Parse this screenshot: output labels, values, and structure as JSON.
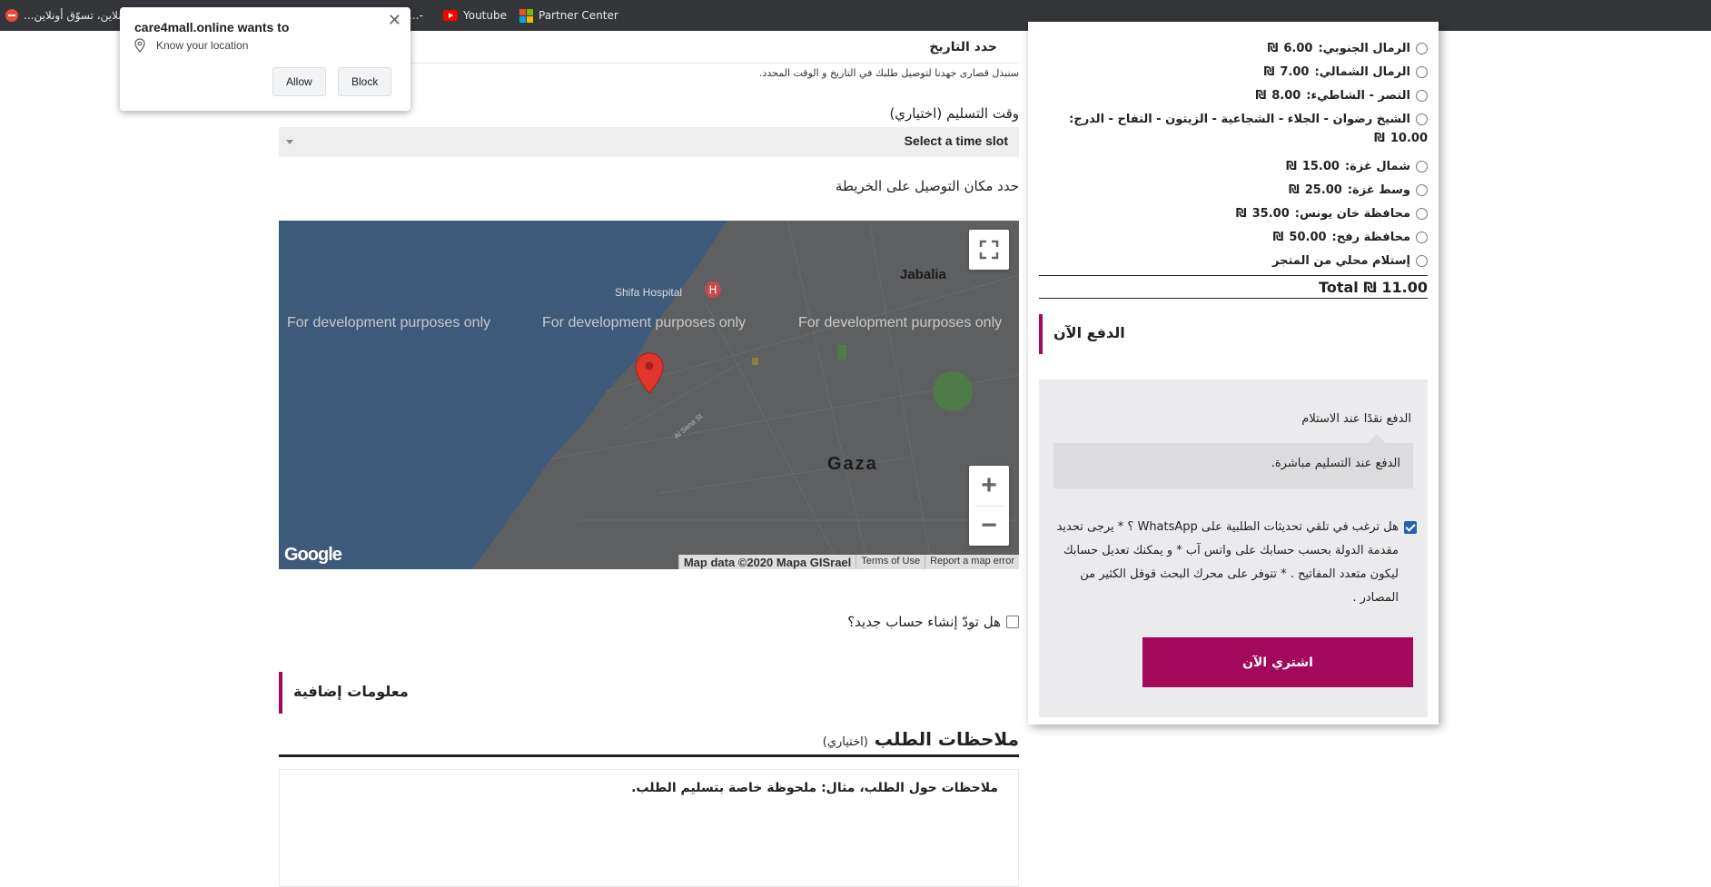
{
  "bookmarks": {
    "item1": "كارفور أونلاين، تسوّق أونلاين...",
    "item2": "...-",
    "youtube": "Youtube",
    "partner": "Partner Center"
  },
  "permission_popup": {
    "title": "care4mall.online wants to",
    "location": "Know your location",
    "allow": "Allow",
    "block": "Block"
  },
  "delivery": {
    "date_value": "حدد التاريخ",
    "date_note": "سنبذل قصارى جهدنا لتوصيل طلبك في التاريخ و الوقت المحدد.",
    "time_label": "وقت التسليم (اختياري)",
    "time_select": "Select a time slot",
    "map_label": "حدد مكان التوصيل على الخريطة"
  },
  "map": {
    "dev_text": "For development purposes only",
    "places": {
      "jabalia": "Jabalia",
      "shifa": "Shifa Hospital",
      "gaza": "Gaza",
      "street": "Al Sena St"
    },
    "attribution": {
      "data": "Map data ©2020 Mapa GISrael",
      "terms": "Terms of Use",
      "report": "Report a map error"
    },
    "logo": "Google"
  },
  "account": {
    "create_label": "هل تودّ إنشاء حساب جديد؟"
  },
  "additional": {
    "heading": "معلومات إضافية",
    "notes_title": "ملاحظات الطلب",
    "notes_optional": "(اختياري)",
    "notes_placeholder": "ملاحظات حول الطلب، مثال: ملحوظة خاصة بتسليم الطلب."
  },
  "shipping": {
    "options": [
      {
        "label": "الرمال الجنوبي:",
        "price": "6.00",
        "currency": "₪"
      },
      {
        "label": "الرمال الشمالي:",
        "price": "7.00",
        "currency": "₪"
      },
      {
        "label": "التصر - الشاطيء:",
        "price": "8.00",
        "currency": "₪"
      },
      {
        "label": "الشيخ رضوان - الجلاء - الشجاعية - الزيتون - التفاح - الدرج:",
        "price": "10.00",
        "currency": "₪"
      },
      {
        "label": "شمال غزة:",
        "price": "15.00",
        "currency": "₪"
      },
      {
        "label": "وسط غزة:",
        "price": "25.00",
        "currency": "₪"
      },
      {
        "label": "محافظة خان يونس:",
        "price": "35.00",
        "currency": "₪"
      },
      {
        "label": "محافظة رفح:",
        "price": "50.00",
        "currency": "₪"
      },
      {
        "label": "إستلام محلي من المتجر",
        "price": "",
        "currency": ""
      }
    ]
  },
  "total": {
    "label": "Total",
    "value": "11.00",
    "currency": "₪"
  },
  "payment": {
    "heading": "الدفع الآن",
    "method": "الدفع نقدًا عند الاستلام",
    "description": "الدفع عند التسليم مباشرة.",
    "whatsapp_text": "هل ترغب في تلقي تحديثات الطلبية على WhatsApp ؟ * يرجى تحديد مقدمة الدولة بحسب حسابك على واتس آب * و يمكنك تعديل حسابك ليكون متعدد المفاتيح . * تتوفر على محرك البحث قوقل الكثير من المصادر .",
    "buy_button": "اشتري الآن"
  },
  "colors": {
    "accent": "#a3085a",
    "topbar": "#35363a",
    "map_sea": "#3d5a7a",
    "map_land": "#5e5f61"
  }
}
